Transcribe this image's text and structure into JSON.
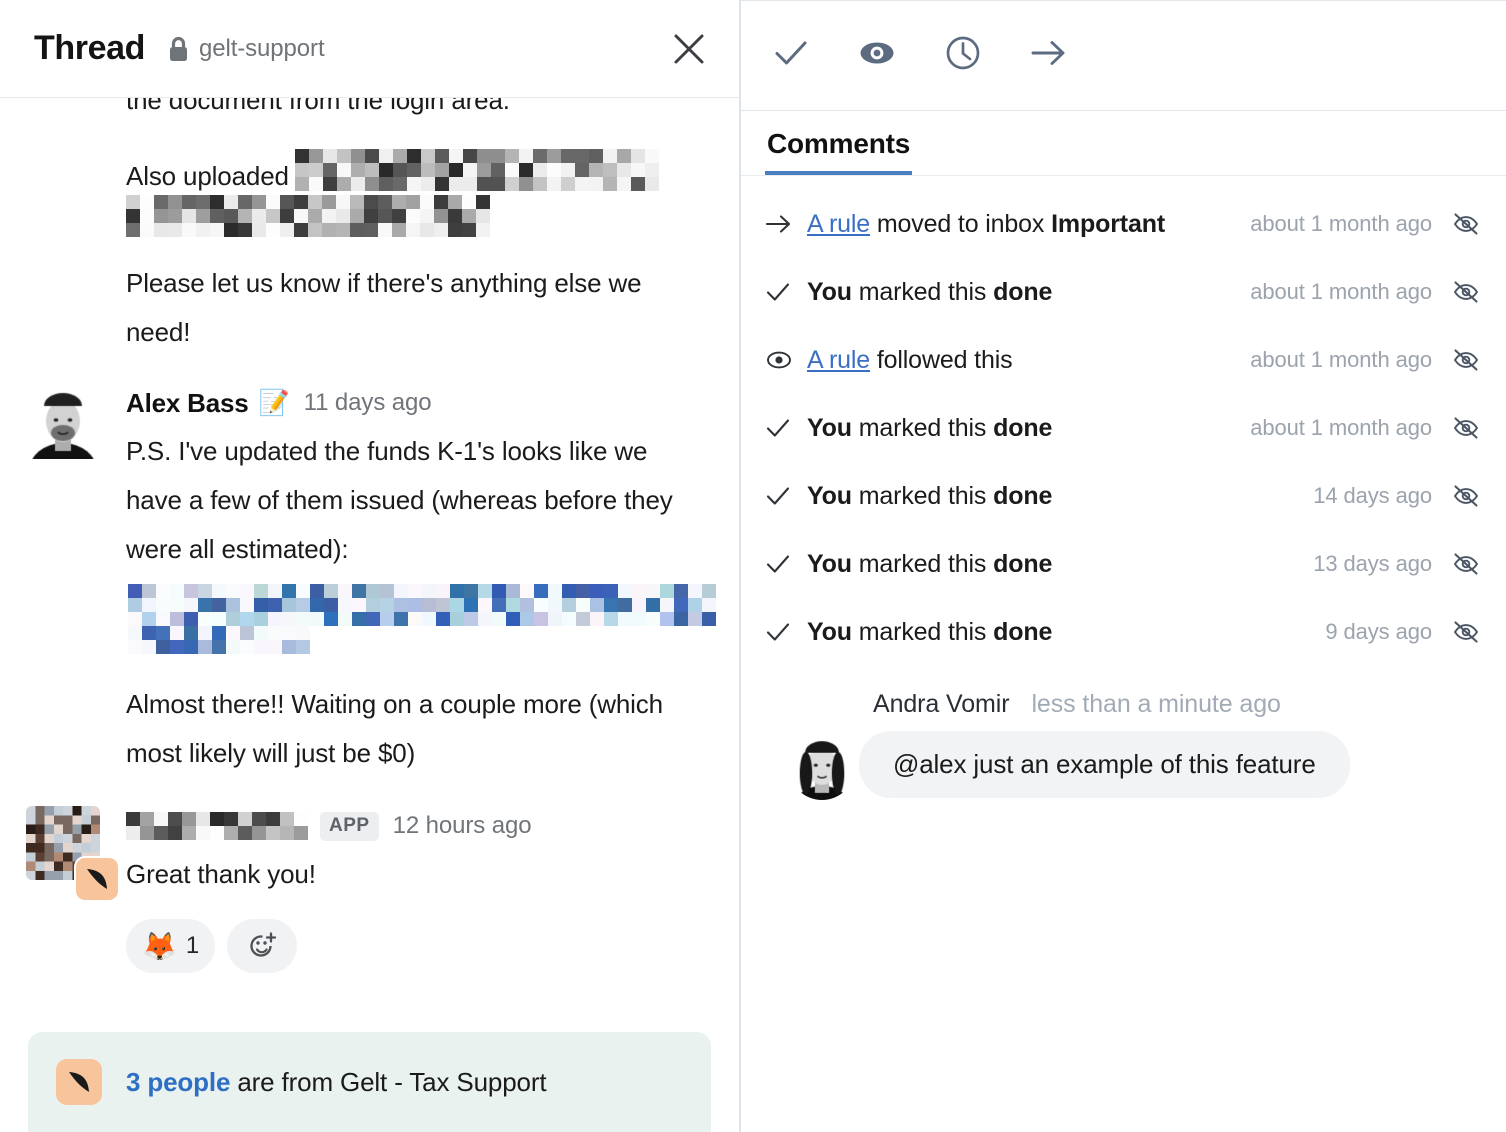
{
  "thread": {
    "title": "Thread",
    "lock_icon": "lock-icon",
    "channel": "gelt-support",
    "close_icon": "close-icon",
    "messages": [
      {
        "id": "msg-truncated",
        "paragraphs": [
          "the document from the login area.",
          "Also uploaded",
          "Please let us know if there's anything else we need!"
        ],
        "redacted": true
      },
      {
        "id": "msg-alex",
        "author": "Alex Bass",
        "author_emoji": "📝",
        "time": "11 days ago",
        "avatar": "alex-avatar",
        "body_1": "P.S. I've updated the funds K-1's looks like we have a few of them issued (whereas before they were all estimated):",
        "body_2": "Almost there!! Waiting on a couple more (which most likely will just be $0)"
      },
      {
        "id": "msg-app",
        "author_redacted": true,
        "app_tag": "APP",
        "time": "12 hours ago",
        "avatar": "redacted-avatar",
        "badge_icon": "missive-badge-icon",
        "body": "Great thank you!",
        "reactions": [
          {
            "emoji": "🦊",
            "emoji_name": "fox-emoji",
            "count": "1"
          }
        ],
        "add_reaction_icon": "add-reaction-icon"
      }
    ],
    "people_banner": {
      "badge_icon": "missive-badge-icon",
      "link_text": "3 people",
      "rest_text": " are from Gelt - Tax Support"
    }
  },
  "right": {
    "toolbar": [
      {
        "name": "mark-done-button",
        "icon": "check-icon"
      },
      {
        "name": "follow-button",
        "icon": "eye-filled-icon"
      },
      {
        "name": "snooze-button",
        "icon": "clock-icon"
      },
      {
        "name": "move-button",
        "icon": "arrow-right-icon"
      }
    ],
    "tabs": [
      {
        "label": "Comments",
        "active": true
      }
    ],
    "events": [
      {
        "icon": "arrow-right-icon",
        "actor": "A rule",
        "actor_is_link": true,
        "middle": " moved to inbox ",
        "emphasis": "Important",
        "time": "about 1 month ago",
        "mute_icon": "eye-slash-icon"
      },
      {
        "icon": "check-icon",
        "actor": "You",
        "actor_is_link": false,
        "middle": " marked this ",
        "emphasis": "done",
        "time": "about 1 month ago",
        "mute_icon": "eye-slash-icon"
      },
      {
        "icon": "eye-outline-icon",
        "actor": "A rule",
        "actor_is_link": true,
        "middle": " followed this",
        "emphasis": "",
        "time": "about 1 month ago",
        "mute_icon": "eye-slash-icon"
      },
      {
        "icon": "check-icon",
        "actor": "You",
        "actor_is_link": false,
        "middle": " marked this ",
        "emphasis": "done",
        "time": "about 1 month ago",
        "mute_icon": "eye-slash-icon"
      },
      {
        "icon": "check-icon",
        "actor": "You",
        "actor_is_link": false,
        "middle": " marked this ",
        "emphasis": "done",
        "time": "14 days ago",
        "mute_icon": "eye-slash-icon"
      },
      {
        "icon": "check-icon",
        "actor": "You",
        "actor_is_link": false,
        "middle": " marked this ",
        "emphasis": "done",
        "time": "13 days ago",
        "mute_icon": "eye-slash-icon"
      },
      {
        "icon": "check-icon",
        "actor": "You",
        "actor_is_link": false,
        "middle": " marked this ",
        "emphasis": "done",
        "time": "9 days ago",
        "mute_icon": "eye-slash-icon"
      }
    ],
    "comment": {
      "author": "Andra Vomir",
      "time": "less than a minute ago",
      "text": "@alex just an example of this feature",
      "avatar": "andra-avatar"
    }
  },
  "colors": {
    "link_blue": "#3a6fc4",
    "tab_underline": "#4a7fc1",
    "icon_slate": "#5c6b80",
    "banner_bg": "#e9f2ef",
    "badge_orange": "#f7c49c",
    "muted_text": "#9ba3ad"
  }
}
